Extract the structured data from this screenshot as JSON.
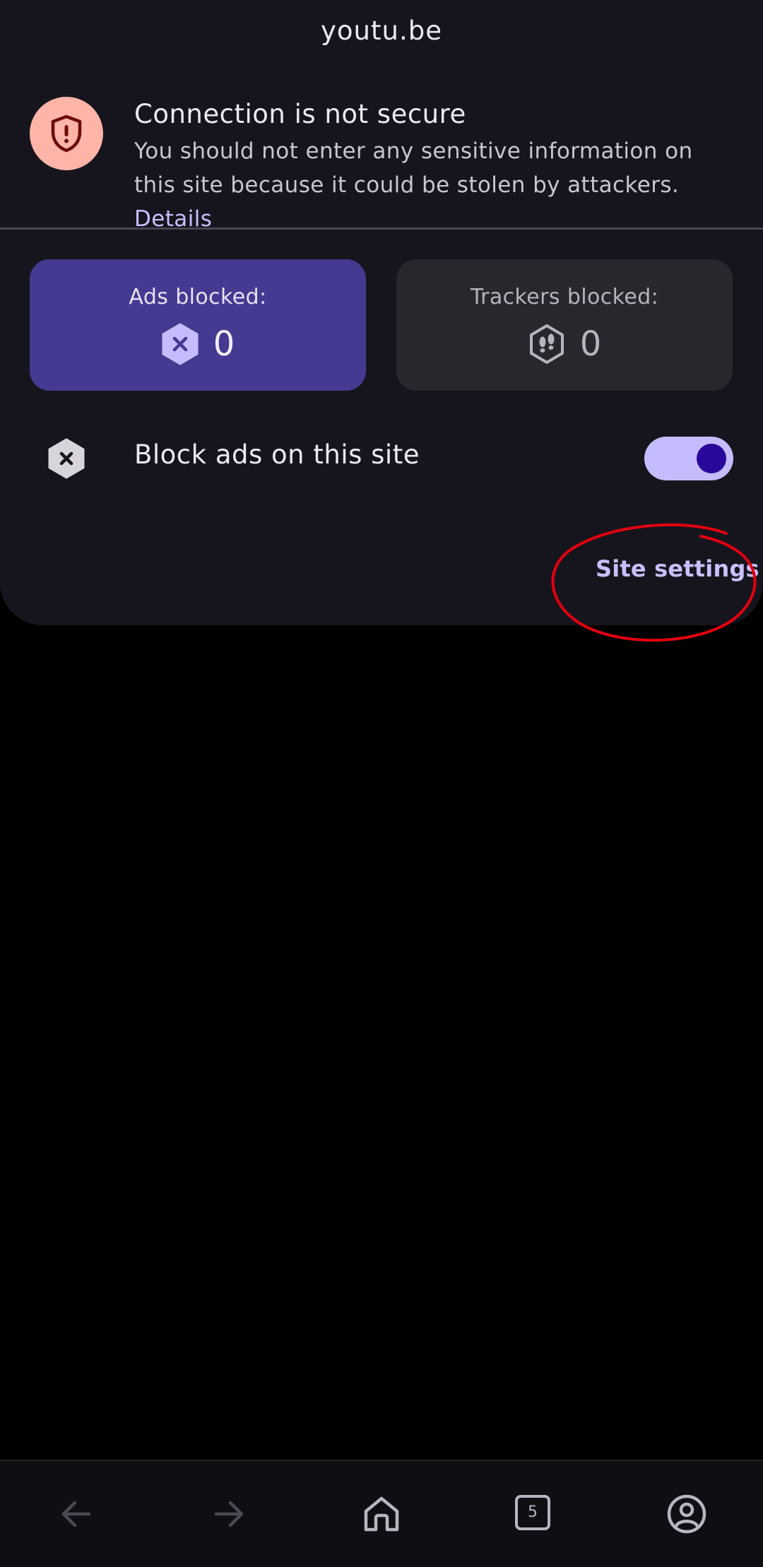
{
  "header": {
    "site": "youtu.be"
  },
  "security": {
    "title": "Connection is not secure",
    "description": "You should not enter any sensitive information on this site because it could be stolen by attackers.",
    "details_link": "Details",
    "icon": "shield-exclamation-icon"
  },
  "stats": {
    "ads": {
      "label": "Ads blocked:",
      "value": "0",
      "icon": "hexagon-x-icon"
    },
    "trackers": {
      "label": "Trackers blocked:",
      "value": "0",
      "icon": "hexagon-footprints-icon"
    }
  },
  "block_ads": {
    "label": "Block ads on this site",
    "enabled": true,
    "icon": "hexagon-x-icon"
  },
  "site_settings": {
    "label": "Site settings"
  },
  "bottom_nav": {
    "tab_count": "5",
    "items": [
      "back-arrow-icon",
      "forward-arrow-icon",
      "home-icon",
      "tabs-icon",
      "account-icon"
    ]
  },
  "colors": {
    "panel_bg": "#16151d",
    "accent": "#c8bfff",
    "ads_card": "#453a91",
    "trackers_card": "#28272d",
    "warning": "#ffb4a8",
    "annotation": "#e3000f"
  }
}
